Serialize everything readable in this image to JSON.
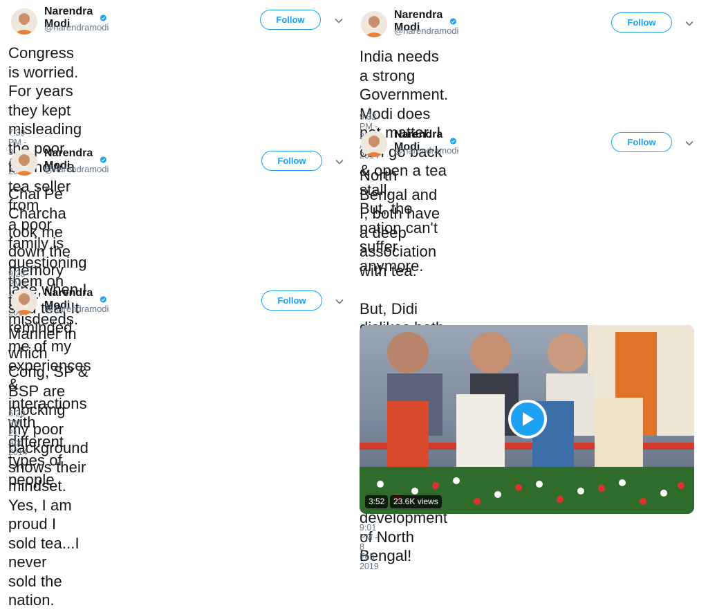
{
  "tweets": [
    {
      "author": "Narendra Modi",
      "handle": "@narendramodi",
      "follow_label": "Follow",
      "text": "Congress is worried. For years they kept\nmisleading the poor but now a tea seller from\na poor family is questioning them on their\nmisdeeds.",
      "timestamp": "7:39 PM - 3 Apr 2014"
    },
    {
      "author": "Narendra Modi",
      "handle": "@narendramodi",
      "follow_label": "Follow",
      "text": "Chai Pe Charcha took me down the memory\nlane,when I sold tea. It reminded me of my\nexperiences & interactions with different\ntypes of people",
      "timestamp": "9:23 PM - 12 Feb 2014"
    },
    {
      "author": "Narendra Modi",
      "handle": "@narendramodi",
      "follow_label": "Follow",
      "text": "Manner in which Cong, SP & BSP are\nmocking my poor background shows their\nmindset. Yes, I am proud I sold tea...I never\nsold the nation.",
      "timestamp": "6:20 PM - 21 Apr 2014"
    },
    {
      "author": "Narendra Modi",
      "handle": "@narendramodi",
      "follow_label": "Follow",
      "text": "India needs a strong Government. Modi does\nnot matter. I can go back & open a tea stall.\nBut, the nation can't suffer anymore.",
      "timestamp": "9:32 PM - 29 Apr 2014"
    },
    {
      "author": "Narendra Modi",
      "handle": "@narendramodi",
      "follow_label": "Follow",
      "text": "North Bengal and I, both have a deep\nassociation with tea.\n\nBut, Didi dislikes both the tea sector and the\ntea-seller.\n\nNo wonder she is not working for the\ndevelopment of North Bengal!",
      "timestamp": "9:01 PM - 8 Feb 2019",
      "video": {
        "duration": "3:52",
        "views": "23.6K views"
      }
    }
  ],
  "icons": {
    "verified": "verified-badge-icon",
    "caret": "chevron-down-icon",
    "play": "play-icon"
  },
  "colors": {
    "brand": "#1da1f2",
    "text": "#14171a",
    "muted": "#657786"
  }
}
